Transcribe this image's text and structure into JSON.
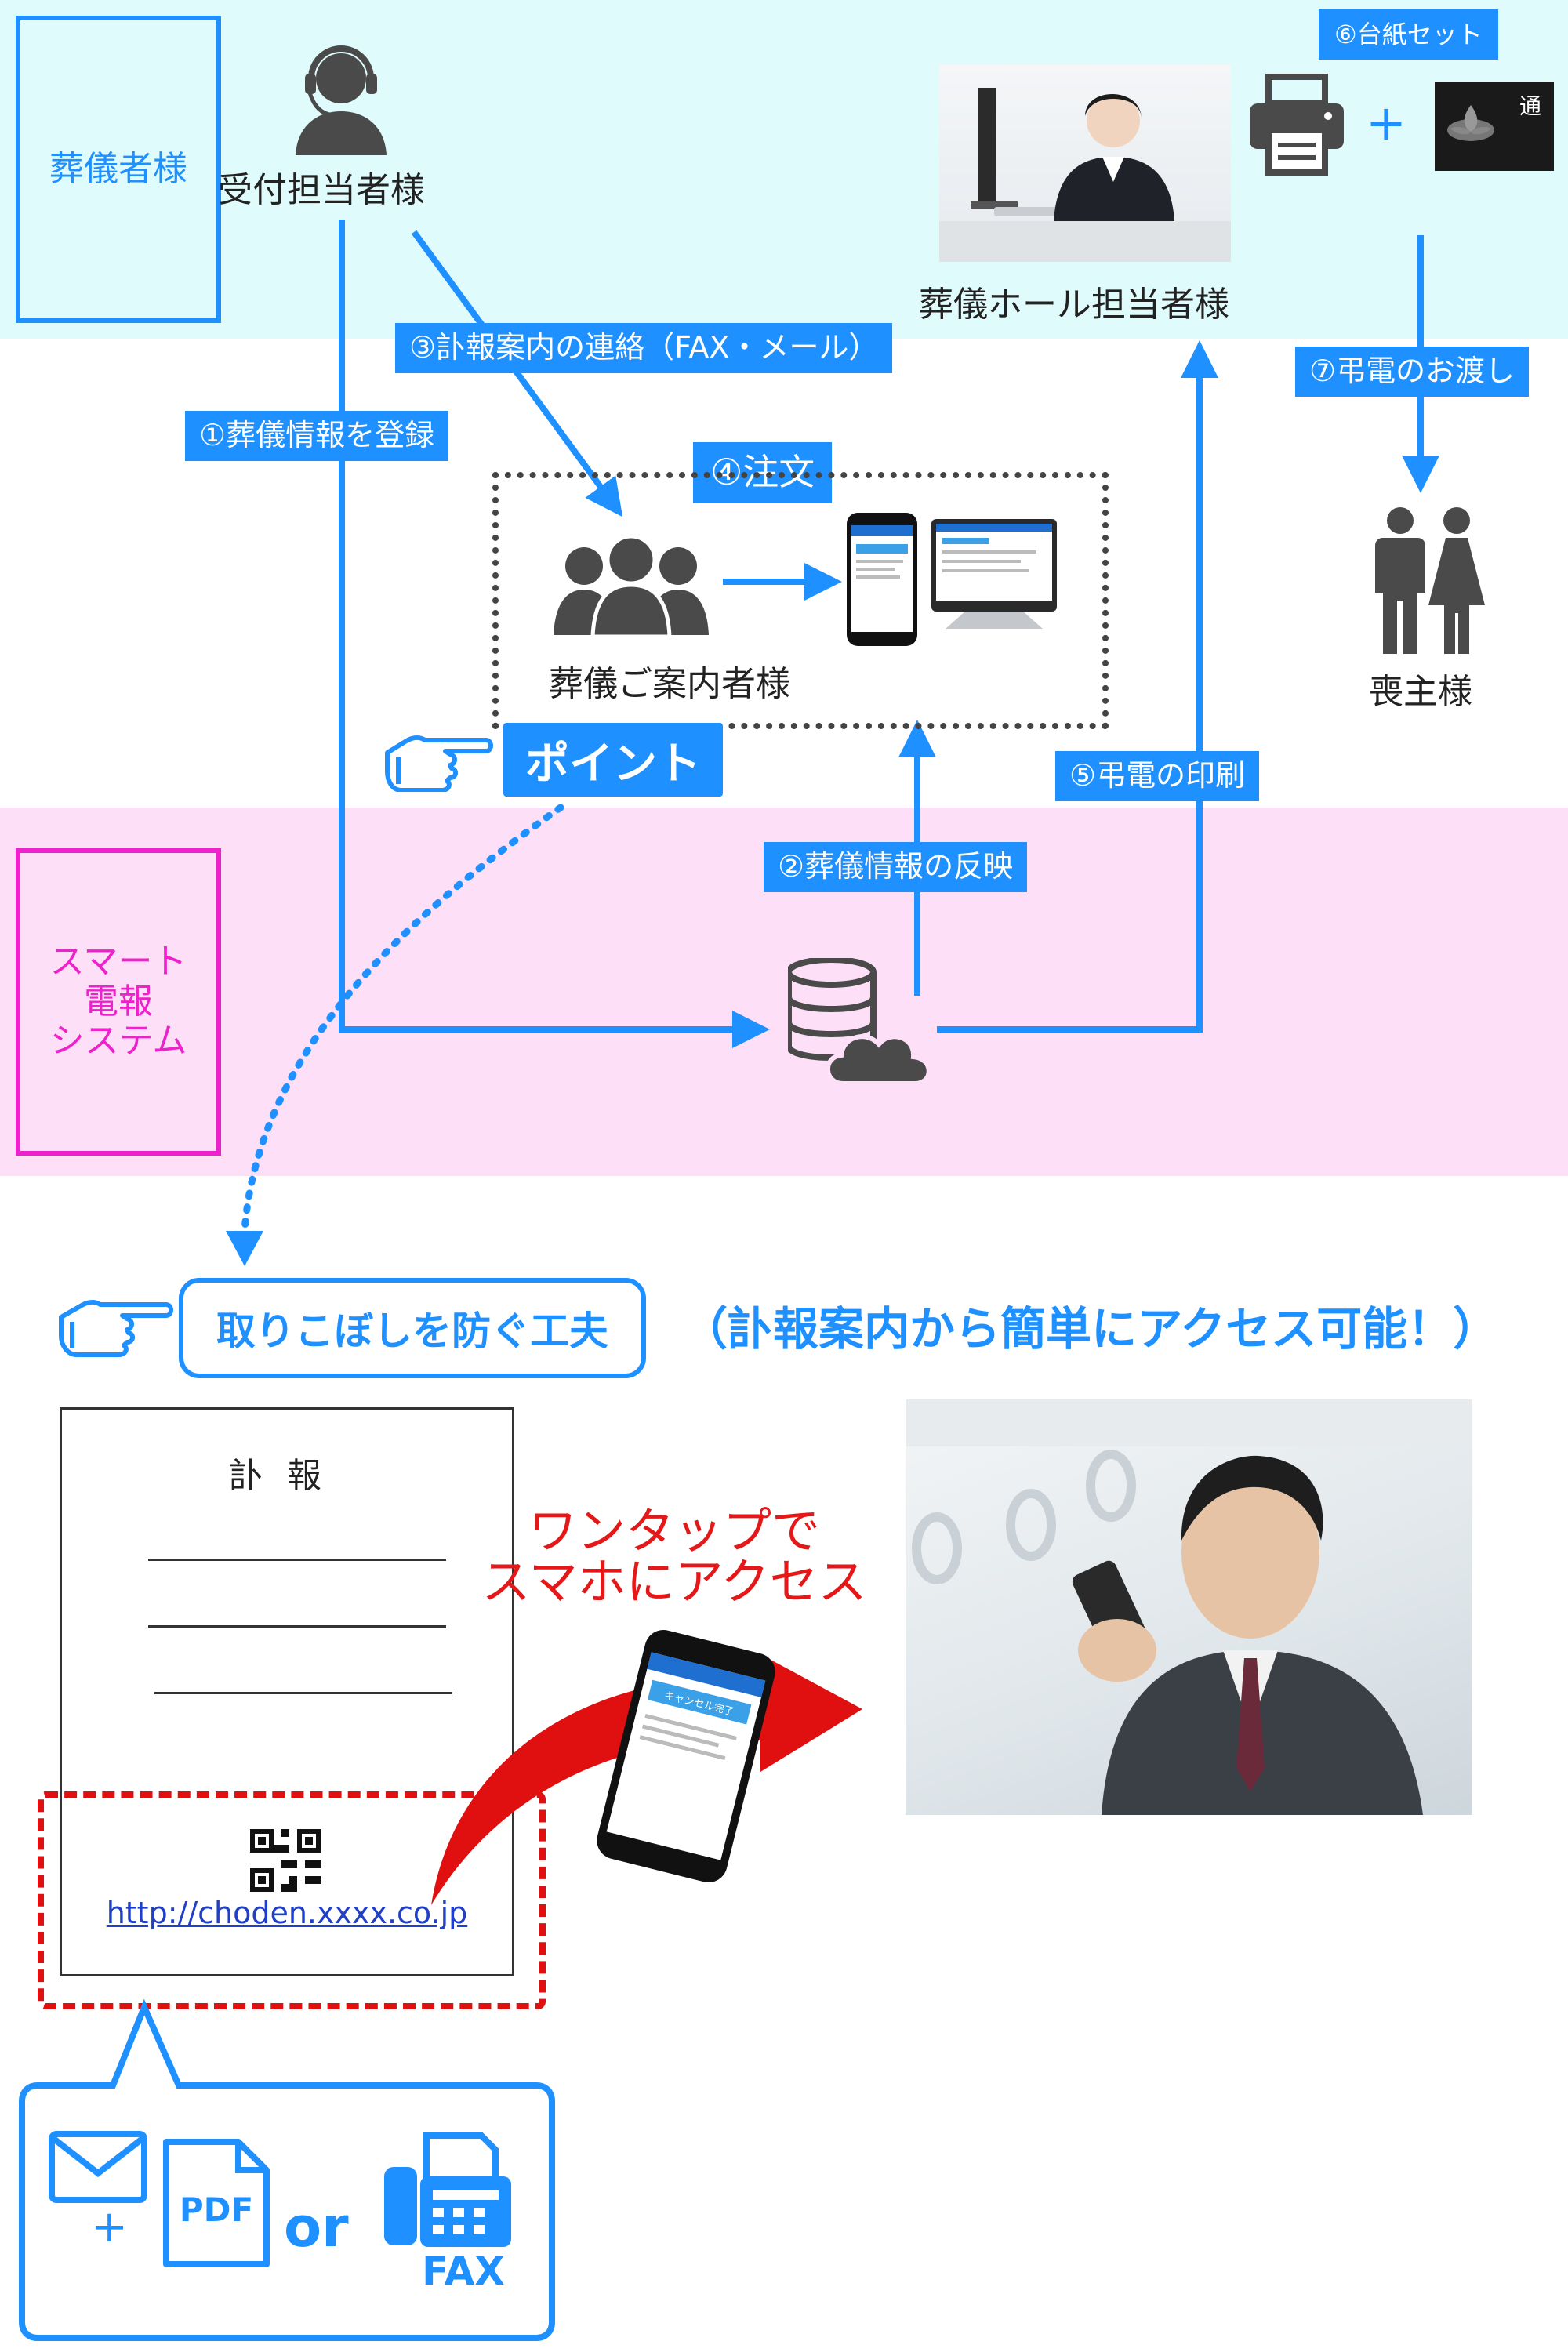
{
  "roles": {
    "funeral_company": "葬儀者様",
    "system": "スマート\n電報\nシステム"
  },
  "actors": {
    "reception": "受付担当者様",
    "hall_staff": "葬儀ホール担当者様",
    "guide": "葬儀ご案内者様",
    "chief_mourner": "喪主様"
  },
  "steps": {
    "s1": "①葬儀情報を登録",
    "s2": "②葬儀情報の反映",
    "s3": "③訃報案内の連絡（FAX・メール）",
    "s4": "④注文",
    "s5": "⑤弔電の印刷",
    "s6": "⑥台紙セット",
    "s7": "⑦弔電のお渡し"
  },
  "plus": "+",
  "point_label": "ポイント",
  "tip": {
    "title": "取りこぼしを防ぐ工夫",
    "access_note": "（訃報案内から簡単にアクセス可能！）"
  },
  "notice": {
    "title": "訃報",
    "url": "http://choden.xxxx.co.jp"
  },
  "onetap": {
    "line1": "ワンタップで",
    "line2": "スマホにアクセス"
  },
  "phone_screen": {
    "button": "キャンセル完了"
  },
  "delivery": {
    "pdf": "PDF",
    "or": "or",
    "fax": "FAX"
  },
  "card_glyph": "通",
  "colors": {
    "accent_blue": "#1e90ff",
    "system_magenta": "#ee22cc",
    "alert_red": "#e01010",
    "band_top": "#e0fbfc",
    "band_mid": "#fde0f7",
    "icon_gray": "#4a4a4a"
  }
}
